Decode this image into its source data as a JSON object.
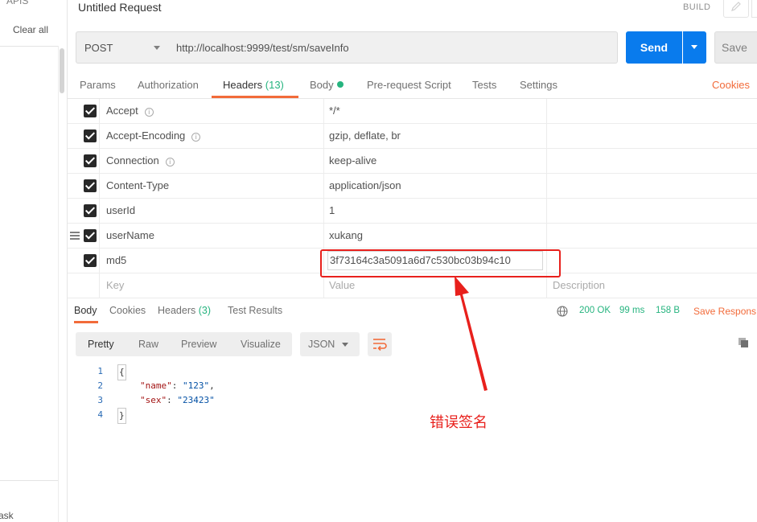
{
  "sidebar": {
    "apis_label": "APIS",
    "clear_all": "Clear all",
    "task_label": "ask"
  },
  "header": {
    "title": "Untitled Request",
    "build_label": "BUILD"
  },
  "request": {
    "method": "POST",
    "url": "http://localhost:9999/test/sm/saveInfo",
    "send_label": "Send",
    "save_label": "Save"
  },
  "request_tabs": {
    "params": "Params",
    "authorization": "Authorization",
    "headers": "Headers",
    "headers_count": "(13)",
    "body": "Body",
    "prerequest": "Pre-request Script",
    "tests": "Tests",
    "settings": "Settings",
    "cookies": "Cookies"
  },
  "headers_table": {
    "rows": [
      {
        "key": "Accept",
        "value": "*/*",
        "info": true
      },
      {
        "key": "Accept-Encoding",
        "value": "gzip, deflate, br",
        "info": true
      },
      {
        "key": "Connection",
        "value": "keep-alive",
        "info": true
      },
      {
        "key": "Content-Type",
        "value": "application/json",
        "info": false
      },
      {
        "key": "userId",
        "value": "1",
        "info": false
      },
      {
        "key": "userName",
        "value": "xukang",
        "info": false
      },
      {
        "key": "md5",
        "value": "3f73164c3a5091a6d7c530bc03b94c10",
        "info": false
      }
    ],
    "placeholders": {
      "key": "Key",
      "value": "Value",
      "description": "Description"
    }
  },
  "annotation": {
    "text": "错误签名",
    "color": "#e8201c"
  },
  "response_tabs": {
    "body": "Body",
    "cookies": "Cookies",
    "headers": "Headers",
    "headers_count": "(3)",
    "test_results": "Test Results"
  },
  "response_status": {
    "status": "200 OK",
    "time": "99 ms",
    "size": "158 B",
    "save_response": "Save Respons"
  },
  "view_modes": {
    "pretty": "Pretty",
    "raw": "Raw",
    "preview": "Preview",
    "visualize": "Visualize",
    "format": "JSON"
  },
  "response_body": {
    "lines": [
      {
        "n": "1",
        "text": "{"
      },
      {
        "n": "2",
        "key": "\"name\"",
        "val": "\"123\"",
        "trail": ","
      },
      {
        "n": "3",
        "key": "\"sex\"",
        "val": "\"23423\"",
        "trail": ""
      },
      {
        "n": "4",
        "text": "}"
      }
    ]
  },
  "colors": {
    "accent": "#f26b3a",
    "send": "#097bed",
    "success": "#26b47f"
  },
  "icons": [
    "info-icon",
    "drag-handle-icon",
    "globe-icon",
    "wrap-lines-icon",
    "copy-icon",
    "edit-icon",
    "chevron-down-icon"
  ]
}
